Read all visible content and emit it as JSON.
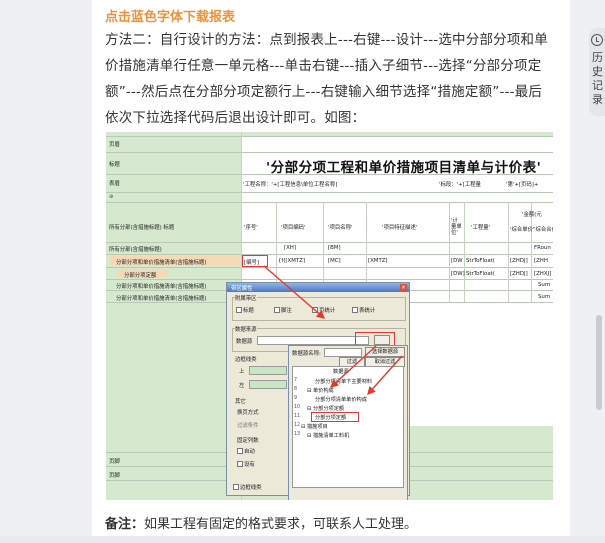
{
  "article": {
    "link_text": "点击蓝色字体下载报表",
    "paragraph": "方法二：自行设计的方法：点到报表上---右键---设计---选中分部分项和单价措施清单行任意一单元格---单击右键---插入子细节---选择“分部分项定额”---然后点在分部分项定额行上---右键输入细节选择“措施定额”---最后依次下拉选择代码后退出设计即可。如图：",
    "note_label": "备注：",
    "note_text": "如果工程有固定的格式要求，可联系人工处理。"
  },
  "history_tab": {
    "label": "历史记录",
    "icon": "history-icon"
  },
  "screenshot": {
    "report_title": "'分部分项工程和单价措施项目清单与计价表'",
    "left_labels": [
      "页眉",
      "标题",
      "表眉",
      "所有分部(含措施标题) 标题",
      "所有分部(含措施标题)",
      "分部分项和单价措施清单(含措施标题)",
      "分部分项定额",
      "分部分项和单价措施清单(含措施标题)",
      "分部分项和单价措施清单(含措施标题)",
      "页脚",
      "页脚"
    ],
    "header_row": "'工程名称：'+[工程信息\\单位工程名称]",
    "header_right": [
      "'标段：'+[工程量",
      "'第'+[页码]+"
    ],
    "columns": [
      "'序号'",
      "'项目编码'",
      "'项目名称'",
      "'项目特征描述'",
      "'计量单位'",
      "'工程量'",
      "'综合单价'",
      "'综合合价'"
    ],
    "money_header": "'金额(元",
    "cells": [
      "[XH]",
      "[BM]",
      "[MC]",
      "[编号]",
      "{f([XMTZ]",
      "[MC]",
      "[XMTZ]",
      "[DW",
      "StrToFloat(",
      "[ZHDJ]",
      "[ZHH",
      "[DW]",
      "StrToFloat(",
      "[ZHDJ]",
      "[ZHXJ]",
      "FRoun",
      "Sum",
      "Sum"
    ],
    "dialog": {
      "title": "带区属性",
      "group_attr": "附属带区",
      "checks": [
        "标题",
        "脚注",
        "页统计",
        "表统计"
      ],
      "group_source": "数据来源",
      "source_label": "数据源",
      "border_label": "边框线类",
      "up": "上",
      "left": "左",
      "other": "其它",
      "wrap": "换页方式",
      "filter": "过滤条件",
      "fixed": "固定列数",
      "auto": "自动",
      "allow": "设有",
      "bottom": "边框线类"
    },
    "popup": {
      "name_label": "数据源名称:",
      "select_btn": "选择数据源",
      "filter_btn": "过滤",
      "cancel_btn": "取消过滤",
      "tree_header": "数据源",
      "rows": [
        {
          "n": "7",
          "text": "分部分项清单下主要材料"
        },
        {
          "n": "8",
          "text": "⊟ 单价构成"
        },
        {
          "n": "9",
          "text": "分部分项清单单价构成"
        },
        {
          "n": "10",
          "text": "⊟ 分部分项定额"
        },
        {
          "n": "11",
          "text": "分部分项定额"
        },
        {
          "n": "12",
          "text": "⊟ 措施项目"
        },
        {
          "n": "13",
          "text": "⊟ 措施清单工料机"
        }
      ]
    }
  }
}
